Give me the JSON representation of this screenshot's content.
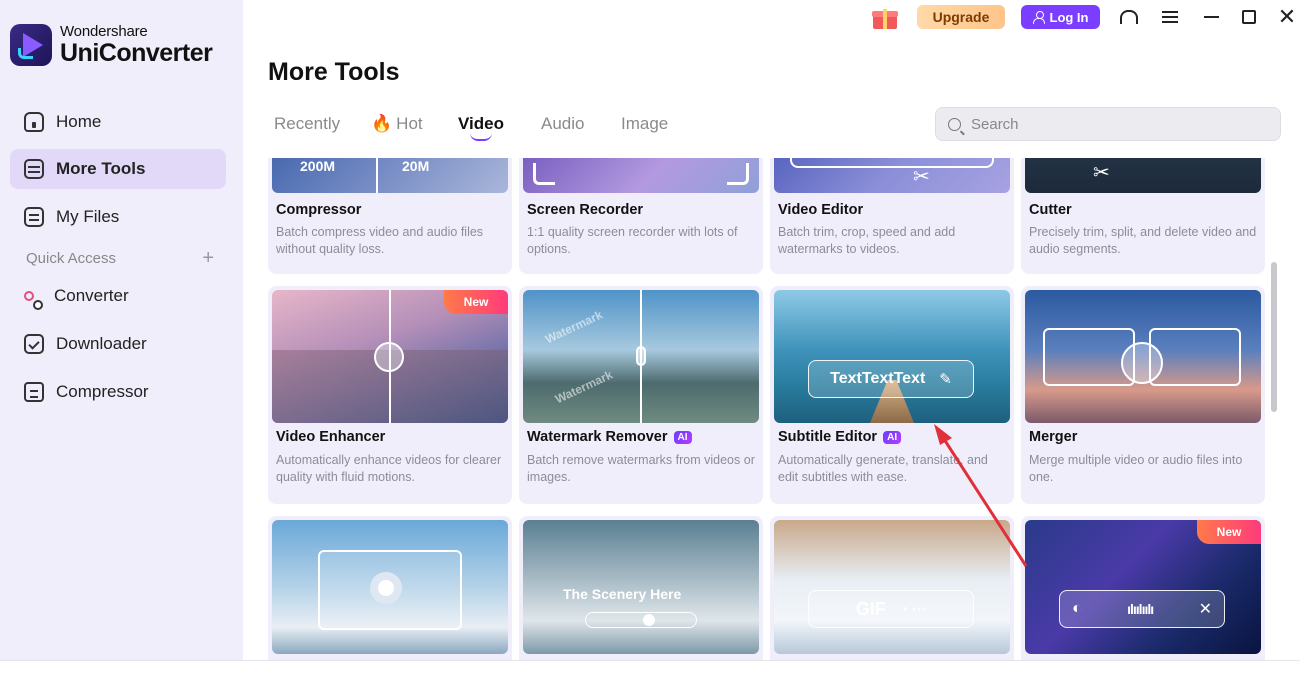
{
  "app": {
    "brand_small": "Wondershare",
    "brand_big": "UniConverter"
  },
  "sidebar": {
    "items": [
      {
        "label": "Home",
        "icon": "home-icon",
        "active": false
      },
      {
        "label": "More Tools",
        "icon": "toolbox-icon",
        "active": true
      },
      {
        "label": "My Files",
        "icon": "files-icon",
        "active": false
      }
    ],
    "quick_access_label": "Quick Access",
    "quick_items": [
      {
        "label": "Converter",
        "icon": "converter-icon"
      },
      {
        "label": "Downloader",
        "icon": "downloader-icon"
      },
      {
        "label": "Compressor",
        "icon": "compressor-icon"
      }
    ]
  },
  "topbar": {
    "upgrade_label": "Upgrade",
    "login_label": "Log In"
  },
  "main": {
    "title": "More Tools",
    "tabs": [
      "Recently",
      "Hot",
      "Video",
      "Audio",
      "Image"
    ],
    "active_tab": "Video",
    "search_placeholder": "Search"
  },
  "cards": [
    {
      "title": "Compressor",
      "desc": "Batch compress video and audio files without quality loss.",
      "thumb_text_left": "200M",
      "thumb_text_right": "20M"
    },
    {
      "title": "Screen Recorder",
      "desc": "1:1 quality screen recorder with lots of options."
    },
    {
      "title": "Video Editor",
      "desc": "Batch trim, crop, speed and add watermarks to videos."
    },
    {
      "title": "Cutter",
      "desc": "Precisely trim, split, and delete video and audio segments."
    },
    {
      "title": "Video Enhancer",
      "desc": "Automatically enhance videos for clearer quality with fluid motions.",
      "badge": "New"
    },
    {
      "title": "Watermark Remover",
      "desc": "Batch remove watermarks from videos or images.",
      "badge_ai": "AI",
      "watermark_text": "Watermark"
    },
    {
      "title": "Subtitle Editor",
      "desc": "Automatically generate, translate, and edit subtitles with ease.",
      "badge_ai": "AI",
      "thumb_text": "TextTextText"
    },
    {
      "title": "Merger",
      "desc": "Merge multiple video or audio files into one."
    },
    {
      "title": "",
      "desc": ""
    },
    {
      "title": "",
      "desc": "",
      "thumb_text": "The Scenery Here"
    },
    {
      "title": "",
      "desc": "",
      "thumb_text": "GIF"
    },
    {
      "title": "",
      "desc": "",
      "badge": "New"
    }
  ],
  "colors": {
    "accent": "#7b3dff",
    "sidebar_bg": "#f1eefb",
    "active_item": "#e2d9f8",
    "upgrade": "#ffc48a",
    "arrow": "#e0313b"
  }
}
